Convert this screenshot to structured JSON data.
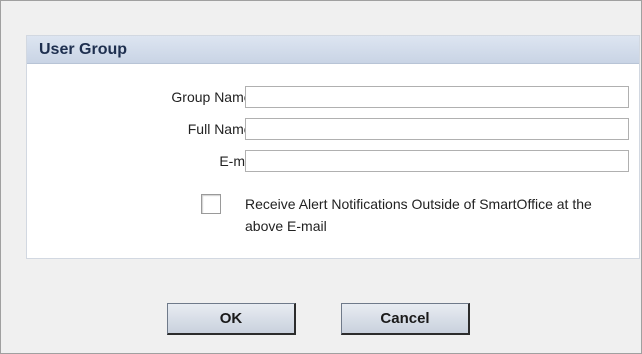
{
  "panel": {
    "title": "User Group"
  },
  "form": {
    "group_name": {
      "label": "Group Name",
      "required_marker": "*",
      "value": ""
    },
    "full_name": {
      "label": "Full Name",
      "required_marker": "*",
      "value": ""
    },
    "email": {
      "label": "E-mail",
      "value": ""
    },
    "alert_checkbox": {
      "checked": false,
      "label": "Receive Alert Notifications Outside of SmartOffice at the above E-mail"
    }
  },
  "buttons": {
    "ok_label": "OK",
    "cancel_label": "Cancel"
  }
}
